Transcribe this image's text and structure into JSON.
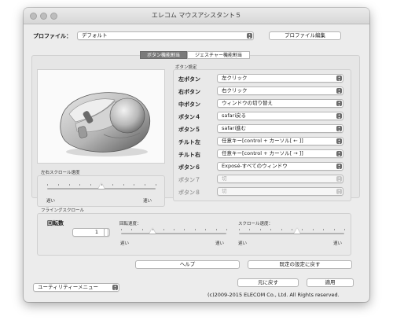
{
  "window": {
    "title": "エレコム マウスアシスタント５",
    "traffic_lights": [
      "close-icon",
      "minimize-icon",
      "zoom-icon"
    ]
  },
  "profile": {
    "label": "プロファイル：",
    "value": "デフォルト",
    "edit_button": "プロファイル編集"
  },
  "tabs": [
    {
      "label": "ボタン機能割当",
      "active": true
    },
    {
      "label": "ジェスチャー機能割当",
      "active": false
    }
  ],
  "left_panel": {
    "scroll_speed_label": "左右スクロール速度",
    "slow": "遅い",
    "fast": "速い",
    "scroll_speed_value": 0.5
  },
  "button_settings": {
    "header": "ボタン設定",
    "rows": [
      {
        "label": "左ボタン",
        "value": "左クリック",
        "enabled": true
      },
      {
        "label": "右ボタン",
        "value": "右クリック",
        "enabled": true
      },
      {
        "label": "中ボタン",
        "value": "ウィンドウの切り替え",
        "enabled": true
      },
      {
        "label": "ボタン４",
        "value": "safari戻る",
        "enabled": true
      },
      {
        "label": "ボタン５",
        "value": "safari進む",
        "enabled": true
      },
      {
        "label": "チルト左",
        "value": "任意キー[control + カーソル[ ← ]]",
        "enabled": true
      },
      {
        "label": "チルト右",
        "value": "任意キー[control + カーソル[ → ]]",
        "enabled": true
      },
      {
        "label": "ボタン６",
        "value": "Exposé-すべてのウィンドウ",
        "enabled": true
      },
      {
        "label": "ボタン７",
        "value": "切",
        "enabled": false
      },
      {
        "label": "ボタン８",
        "value": "切",
        "enabled": false
      }
    ]
  },
  "flying_scroll": {
    "header": "フライングスクロール",
    "rotation_label": "回転数",
    "rotation_value": "1",
    "rotation_speed_label": "回転速度：",
    "rotation_speed_value": 0.3,
    "scroll_speed_label": "スクロール速度：",
    "scroll_speed_value": 0.55,
    "slow": "遅い",
    "fast": "速い"
  },
  "actions": {
    "help": "ヘルプ",
    "reset": "既定の設定に戻す",
    "revert": "元に戻す",
    "apply": "適用"
  },
  "utility_menu": "ユーティリティーメニュー",
  "copyright": "(c)2009-2015 ELECOM Co., Ltd. All Rights reserved."
}
